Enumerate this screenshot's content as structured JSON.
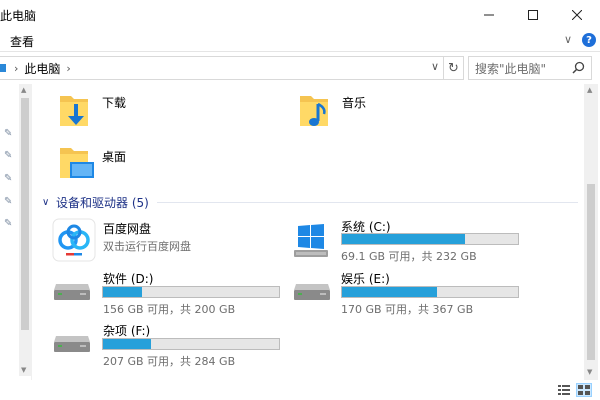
{
  "window": {
    "title": "此电脑",
    "minimize_label": "—",
    "maximize_label": "☐",
    "close_label": "✕"
  },
  "ribbon": {
    "tab_view": "查看",
    "expand_label": "∨",
    "help_label": "?"
  },
  "address": {
    "crumb": "此电脑",
    "sep": "›",
    "dropdown": "∨",
    "refresh": "↻"
  },
  "search": {
    "placeholder": "搜索\"此电脑\""
  },
  "folders": [
    {
      "name": "下载",
      "icon": "download-folder-icon"
    },
    {
      "name": "音乐",
      "icon": "music-folder-icon"
    },
    {
      "name": "桌面",
      "icon": "desktop-folder-icon"
    }
  ],
  "devices_group": {
    "label": "设备和驱动器 (5)",
    "chevron": "∨"
  },
  "devices": [
    {
      "name": "百度网盘",
      "subtitle": "双击运行百度网盘",
      "icon": "baidu-netdisk-icon"
    },
    {
      "name": "系统 (C:)",
      "free": "69.1 GB 可用，共 232 GB",
      "used_fraction": 0.7,
      "icon": "windows-drive-icon"
    },
    {
      "name": "软件 (D:)",
      "free": "156 GB 可用，共 200 GB",
      "used_fraction": 0.22,
      "icon": "hard-drive-icon"
    },
    {
      "name": "娱乐 (E:)",
      "free": "170 GB 可用，共 367 GB",
      "used_fraction": 0.54,
      "icon": "hard-drive-icon"
    },
    {
      "name": "杂项 (F:)",
      "free": "207 GB 可用，共 284 GB",
      "used_fraction": 0.27,
      "icon": "hard-drive-icon"
    }
  ],
  "colors": {
    "drive_fill": "#26a0da",
    "group_header": "#1e3287",
    "folder": "#f5c451"
  }
}
